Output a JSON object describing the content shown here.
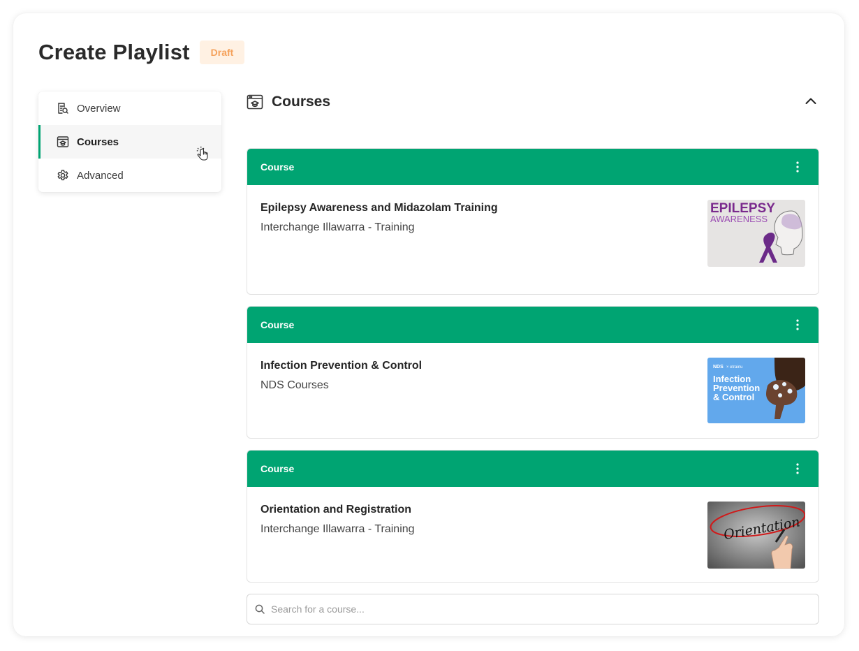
{
  "header": {
    "title": "Create Playlist",
    "status_badge": "Draft"
  },
  "sidebar": {
    "items": [
      {
        "label": "Overview",
        "icon": "document-search-icon"
      },
      {
        "label": "Courses",
        "icon": "course-window-icon",
        "active": true
      },
      {
        "label": "Advanced",
        "icon": "gear-icon"
      }
    ]
  },
  "courses_section": {
    "title": "Courses",
    "icon": "course-window-icon",
    "collapse_icon": "chevron-up-icon",
    "cards": [
      {
        "header_label": "Course",
        "title": "Epilepsy Awareness and Midazolam Training",
        "provider": "Interchange Illawarra - Training",
        "thumbnail_text": [
          "EPILEPSY",
          "AWARENESS"
        ]
      },
      {
        "header_label": "Course",
        "title": "Infection Prevention & Control",
        "provider": "NDS Courses",
        "thumbnail_text": [
          "NDS",
          "× etrainu",
          "Infection",
          "Prevention",
          "& Control"
        ]
      },
      {
        "header_label": "Course",
        "title": "Orientation and Registration",
        "provider": "Interchange Illawarra - Training",
        "thumbnail_text": [
          "Orientation"
        ]
      }
    ]
  },
  "search": {
    "placeholder": "Search for a course..."
  },
  "colors": {
    "accent_green": "#00a472",
    "draft_bg": "#fff1e3",
    "draft_text": "#f5a25c"
  }
}
